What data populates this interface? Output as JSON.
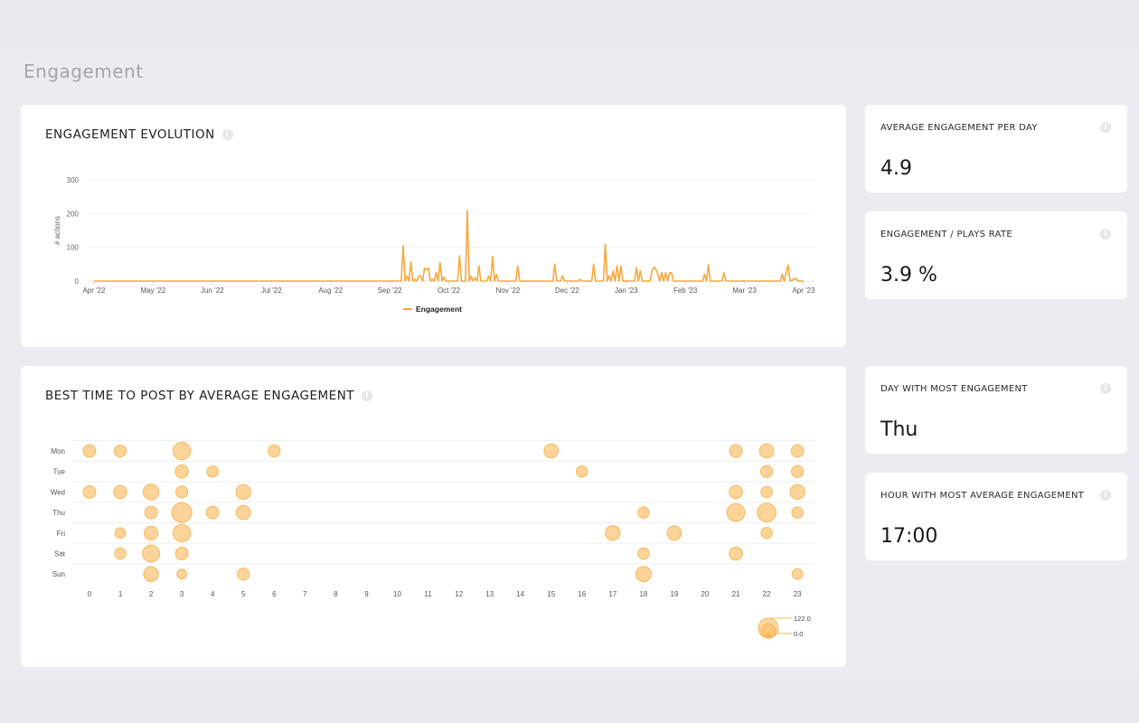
{
  "page": {
    "title": "Engagement"
  },
  "evolution": {
    "title": "ENGAGEMENT EVOLUTION",
    "info_icon": "info-icon"
  },
  "best_time": {
    "title": "BEST TIME TO POST BY AVERAGE ENGAGEMENT",
    "info_icon": "info-icon"
  },
  "kpis": [
    {
      "label": "AVERAGE ENGAGEMENT PER DAY",
      "value": "4.9"
    },
    {
      "label": "ENGAGEMENT / PLAYS RATE",
      "value": "3.9 %"
    },
    {
      "label": "DAY WITH MOST ENGAGEMENT",
      "value": "Thu"
    },
    {
      "label": "HOUR WITH MOST AVERAGE ENGAGEMENT",
      "value": "17:00"
    }
  ],
  "colors": {
    "accent": "#f9a83a",
    "bubble_fill": "#fcd49a",
    "bubble_stroke": "#f6b85c"
  },
  "chart_data": [
    {
      "type": "line",
      "title": "ENGAGEMENT EVOLUTION",
      "xlabel": "",
      "ylabel": "# actions",
      "ylim": [
        0,
        300
      ],
      "yticks": [
        "0",
        "100",
        "200",
        "300"
      ],
      "xticks": [
        "Apr '22",
        "May '22",
        "Jun '22",
        "Jul '22",
        "Aug '22",
        "Sep '22",
        "Oct '22",
        "Nov '22",
        "Dec '22",
        "Jan '23",
        "Feb '23",
        "Mar '23",
        "Apr '23"
      ],
      "x_unit": "days since Apr 1 2022",
      "x_range": [
        0,
        365
      ],
      "grid": true,
      "legend": "bottom-center",
      "series": [
        {
          "name": "Engagement",
          "points": [
            [
              0,
              0
            ],
            [
              158,
              0
            ],
            [
              159,
              105
            ],
            [
              160,
              0
            ],
            [
              161,
              15
            ],
            [
              162,
              0
            ],
            [
              163,
              57
            ],
            [
              164,
              0
            ],
            [
              165,
              5
            ],
            [
              166,
              0
            ],
            [
              167,
              15
            ],
            [
              168,
              15
            ],
            [
              169,
              0
            ],
            [
              170,
              38
            ],
            [
              171,
              35
            ],
            [
              172,
              38
            ],
            [
              173,
              0
            ],
            [
              174,
              5
            ],
            [
              175,
              0
            ],
            [
              176,
              25
            ],
            [
              177,
              0
            ],
            [
              178,
              55
            ],
            [
              179,
              0
            ],
            [
              180,
              12
            ],
            [
              181,
              0
            ],
            [
              187,
              0
            ],
            [
              188,
              75
            ],
            [
              189,
              0
            ],
            [
              191,
              0
            ],
            [
              192,
              210
            ],
            [
              193,
              0
            ],
            [
              194,
              15
            ],
            [
              195,
              0
            ],
            [
              196,
              10
            ],
            [
              197,
              0
            ],
            [
              198,
              45
            ],
            [
              199,
              0
            ],
            [
              202,
              0
            ],
            [
              203,
              15
            ],
            [
              204,
              0
            ],
            [
              205,
              73
            ],
            [
              206,
              0
            ],
            [
              207,
              20
            ],
            [
              208,
              0
            ],
            [
              217,
              0
            ],
            [
              218,
              45
            ],
            [
              219,
              0
            ],
            [
              236,
              0
            ],
            [
              237,
              50
            ],
            [
              238,
              0
            ],
            [
              240,
              0
            ],
            [
              241,
              15
            ],
            [
              242,
              0
            ],
            [
              249,
              0
            ],
            [
              250,
              5
            ],
            [
              251,
              0
            ],
            [
              256,
              0
            ],
            [
              257,
              50
            ],
            [
              258,
              0
            ],
            [
              262,
              0
            ],
            [
              263,
              110
            ],
            [
              264,
              0
            ],
            [
              265,
              15
            ],
            [
              266,
              0
            ],
            [
              267,
              30
            ],
            [
              268,
              0
            ],
            [
              269,
              45
            ],
            [
              270,
              0
            ],
            [
              271,
              45
            ],
            [
              272,
              0
            ],
            [
              278,
              0
            ],
            [
              279,
              40
            ],
            [
              280,
              0
            ],
            [
              281,
              30
            ],
            [
              282,
              0
            ],
            [
              286,
              0
            ],
            [
              287,
              30
            ],
            [
              288,
              42
            ],
            [
              289,
              35
            ],
            [
              290,
              20
            ],
            [
              291,
              0
            ],
            [
              292,
              25
            ],
            [
              293,
              0
            ],
            [
              294,
              25
            ],
            [
              295,
              0
            ],
            [
              296,
              25
            ],
            [
              297,
              25
            ],
            [
              298,
              0
            ],
            [
              313,
              0
            ],
            [
              314,
              20
            ],
            [
              315,
              0
            ],
            [
              316,
              48
            ],
            [
              317,
              0
            ],
            [
              323,
              0
            ],
            [
              324,
              25
            ],
            [
              325,
              0
            ],
            [
              353,
              0
            ],
            [
              354,
              20
            ],
            [
              355,
              0
            ],
            [
              357,
              48
            ],
            [
              358,
              0
            ],
            [
              361,
              8
            ],
            [
              362,
              0
            ],
            [
              365,
              0
            ]
          ]
        }
      ]
    },
    {
      "type": "scatter",
      "subtype": "bubble",
      "title": "BEST TIME TO POST BY AVERAGE ENGAGEMENT",
      "xlabel": "",
      "ylabel": "",
      "x_categories": [
        "0",
        "1",
        "2",
        "3",
        "4",
        "5",
        "6",
        "7",
        "8",
        "9",
        "10",
        "11",
        "12",
        "13",
        "14",
        "15",
        "16",
        "17",
        "18",
        "19",
        "20",
        "21",
        "22",
        "23"
      ],
      "y_categories": [
        "Mon",
        "Tue",
        "Wed",
        "Thu",
        "Fri",
        "Sat",
        "Sun"
      ],
      "size_legend": {
        "max_label": "122.0",
        "min_label": "0.0",
        "max": 122,
        "min": 0,
        "placement": "bottom-right"
      },
      "grid": true,
      "points": [
        {
          "day": "Mon",
          "hour": 0,
          "value": 40
        },
        {
          "day": "Mon",
          "hour": 1,
          "value": 35
        },
        {
          "day": "Mon",
          "hour": 3,
          "value": 90
        },
        {
          "day": "Mon",
          "hour": 6,
          "value": 35
        },
        {
          "day": "Mon",
          "hour": 15,
          "value": 55
        },
        {
          "day": "Mon",
          "hour": 21,
          "value": 40
        },
        {
          "day": "Mon",
          "hour": 22,
          "value": 55
        },
        {
          "day": "Mon",
          "hour": 23,
          "value": 38
        },
        {
          "day": "Tue",
          "hour": 3,
          "value": 45
        },
        {
          "day": "Tue",
          "hour": 4,
          "value": 30
        },
        {
          "day": "Tue",
          "hour": 16,
          "value": 30
        },
        {
          "day": "Tue",
          "hour": 22,
          "value": 35
        },
        {
          "day": "Tue",
          "hour": 23,
          "value": 35
        },
        {
          "day": "Wed",
          "hour": 0,
          "value": 40
        },
        {
          "day": "Wed",
          "hour": 1,
          "value": 45
        },
        {
          "day": "Wed",
          "hour": 2,
          "value": 70
        },
        {
          "day": "Wed",
          "hour": 3,
          "value": 35
        },
        {
          "day": "Wed",
          "hour": 5,
          "value": 60
        },
        {
          "day": "Wed",
          "hour": 21,
          "value": 45
        },
        {
          "day": "Wed",
          "hour": 22,
          "value": 30
        },
        {
          "day": "Wed",
          "hour": 23,
          "value": 60
        },
        {
          "day": "Thu",
          "hour": 2,
          "value": 40
        },
        {
          "day": "Thu",
          "hour": 3,
          "value": 122
        },
        {
          "day": "Thu",
          "hour": 4,
          "value": 40
        },
        {
          "day": "Thu",
          "hour": 5,
          "value": 55
        },
        {
          "day": "Thu",
          "hour": 18,
          "value": 30
        },
        {
          "day": "Thu",
          "hour": 21,
          "value": 95
        },
        {
          "day": "Thu",
          "hour": 22,
          "value": 105
        },
        {
          "day": "Thu",
          "hour": 23,
          "value": 30
        },
        {
          "day": "Fri",
          "hour": 1,
          "value": 25
        },
        {
          "day": "Fri",
          "hour": 2,
          "value": 50
        },
        {
          "day": "Fri",
          "hour": 3,
          "value": 90
        },
        {
          "day": "Fri",
          "hour": 17,
          "value": 60
        },
        {
          "day": "Fri",
          "hour": 19,
          "value": 55
        },
        {
          "day": "Fri",
          "hour": 22,
          "value": 30
        },
        {
          "day": "Sat",
          "hour": 1,
          "value": 30
        },
        {
          "day": "Sat",
          "hour": 2,
          "value": 85
        },
        {
          "day": "Sat",
          "hour": 3,
          "value": 40
        },
        {
          "day": "Sat",
          "hour": 18,
          "value": 30
        },
        {
          "day": "Sat",
          "hour": 21,
          "value": 45
        },
        {
          "day": "Sun",
          "hour": 2,
          "value": 60
        },
        {
          "day": "Sun",
          "hour": 3,
          "value": 20
        },
        {
          "day": "Sun",
          "hour": 5,
          "value": 35
        },
        {
          "day": "Sun",
          "hour": 18,
          "value": 65
        },
        {
          "day": "Sun",
          "hour": 23,
          "value": 25
        }
      ]
    }
  ]
}
